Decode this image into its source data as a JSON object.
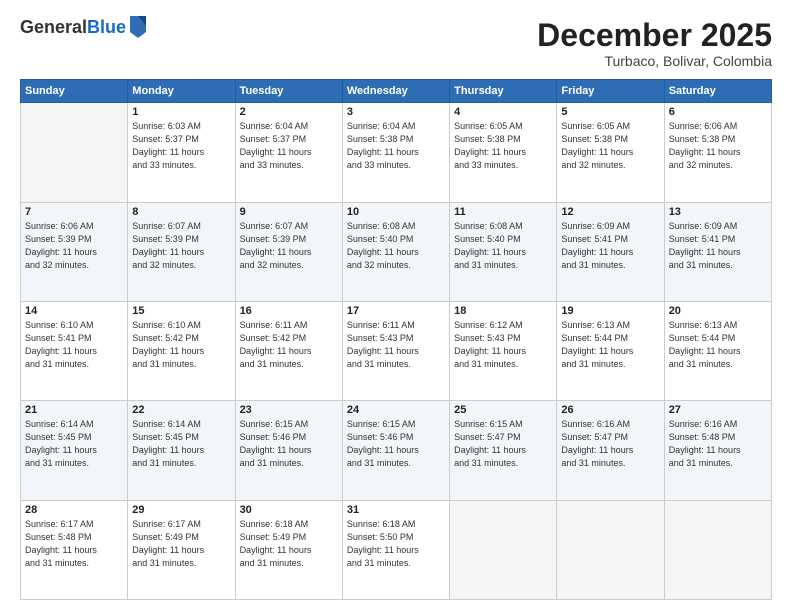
{
  "logo": {
    "general": "General",
    "blue": "Blue"
  },
  "title": "December 2025",
  "subtitle": "Turbaco, Bolivar, Colombia",
  "weekdays": [
    "Sunday",
    "Monday",
    "Tuesday",
    "Wednesday",
    "Thursday",
    "Friday",
    "Saturday"
  ],
  "weeks": [
    [
      {
        "day": null
      },
      {
        "day": 1,
        "sunrise": "6:03 AM",
        "sunset": "5:37 PM",
        "daylight": "11 hours and 33 minutes."
      },
      {
        "day": 2,
        "sunrise": "6:04 AM",
        "sunset": "5:37 PM",
        "daylight": "11 hours and 33 minutes."
      },
      {
        "day": 3,
        "sunrise": "6:04 AM",
        "sunset": "5:38 PM",
        "daylight": "11 hours and 33 minutes."
      },
      {
        "day": 4,
        "sunrise": "6:05 AM",
        "sunset": "5:38 PM",
        "daylight": "11 hours and 33 minutes."
      },
      {
        "day": 5,
        "sunrise": "6:05 AM",
        "sunset": "5:38 PM",
        "daylight": "11 hours and 32 minutes."
      },
      {
        "day": 6,
        "sunrise": "6:06 AM",
        "sunset": "5:38 PM",
        "daylight": "11 hours and 32 minutes."
      }
    ],
    [
      {
        "day": 7,
        "sunrise": "6:06 AM",
        "sunset": "5:39 PM",
        "daylight": "11 hours and 32 minutes."
      },
      {
        "day": 8,
        "sunrise": "6:07 AM",
        "sunset": "5:39 PM",
        "daylight": "11 hours and 32 minutes."
      },
      {
        "day": 9,
        "sunrise": "6:07 AM",
        "sunset": "5:39 PM",
        "daylight": "11 hours and 32 minutes."
      },
      {
        "day": 10,
        "sunrise": "6:08 AM",
        "sunset": "5:40 PM",
        "daylight": "11 hours and 32 minutes."
      },
      {
        "day": 11,
        "sunrise": "6:08 AM",
        "sunset": "5:40 PM",
        "daylight": "11 hours and 31 minutes."
      },
      {
        "day": 12,
        "sunrise": "6:09 AM",
        "sunset": "5:41 PM",
        "daylight": "11 hours and 31 minutes."
      },
      {
        "day": 13,
        "sunrise": "6:09 AM",
        "sunset": "5:41 PM",
        "daylight": "11 hours and 31 minutes."
      }
    ],
    [
      {
        "day": 14,
        "sunrise": "6:10 AM",
        "sunset": "5:41 PM",
        "daylight": "11 hours and 31 minutes."
      },
      {
        "day": 15,
        "sunrise": "6:10 AM",
        "sunset": "5:42 PM",
        "daylight": "11 hours and 31 minutes."
      },
      {
        "day": 16,
        "sunrise": "6:11 AM",
        "sunset": "5:42 PM",
        "daylight": "11 hours and 31 minutes."
      },
      {
        "day": 17,
        "sunrise": "6:11 AM",
        "sunset": "5:43 PM",
        "daylight": "11 hours and 31 minutes."
      },
      {
        "day": 18,
        "sunrise": "6:12 AM",
        "sunset": "5:43 PM",
        "daylight": "11 hours and 31 minutes."
      },
      {
        "day": 19,
        "sunrise": "6:13 AM",
        "sunset": "5:44 PM",
        "daylight": "11 hours and 31 minutes."
      },
      {
        "day": 20,
        "sunrise": "6:13 AM",
        "sunset": "5:44 PM",
        "daylight": "11 hours and 31 minutes."
      }
    ],
    [
      {
        "day": 21,
        "sunrise": "6:14 AM",
        "sunset": "5:45 PM",
        "daylight": "11 hours and 31 minutes."
      },
      {
        "day": 22,
        "sunrise": "6:14 AM",
        "sunset": "5:45 PM",
        "daylight": "11 hours and 31 minutes."
      },
      {
        "day": 23,
        "sunrise": "6:15 AM",
        "sunset": "5:46 PM",
        "daylight": "11 hours and 31 minutes."
      },
      {
        "day": 24,
        "sunrise": "6:15 AM",
        "sunset": "5:46 PM",
        "daylight": "11 hours and 31 minutes."
      },
      {
        "day": 25,
        "sunrise": "6:15 AM",
        "sunset": "5:47 PM",
        "daylight": "11 hours and 31 minutes."
      },
      {
        "day": 26,
        "sunrise": "6:16 AM",
        "sunset": "5:47 PM",
        "daylight": "11 hours and 31 minutes."
      },
      {
        "day": 27,
        "sunrise": "6:16 AM",
        "sunset": "5:48 PM",
        "daylight": "11 hours and 31 minutes."
      }
    ],
    [
      {
        "day": 28,
        "sunrise": "6:17 AM",
        "sunset": "5:48 PM",
        "daylight": "11 hours and 31 minutes."
      },
      {
        "day": 29,
        "sunrise": "6:17 AM",
        "sunset": "5:49 PM",
        "daylight": "11 hours and 31 minutes."
      },
      {
        "day": 30,
        "sunrise": "6:18 AM",
        "sunset": "5:49 PM",
        "daylight": "11 hours and 31 minutes."
      },
      {
        "day": 31,
        "sunrise": "6:18 AM",
        "sunset": "5:50 PM",
        "daylight": "11 hours and 31 minutes."
      },
      {
        "day": null
      },
      {
        "day": null
      },
      {
        "day": null
      }
    ]
  ]
}
